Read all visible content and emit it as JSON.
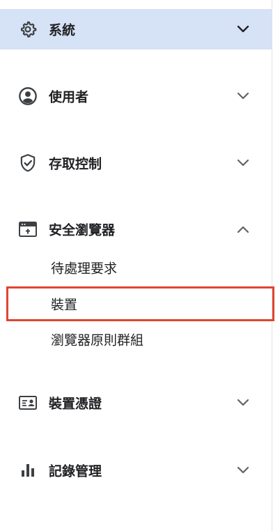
{
  "sidebar": {
    "items": [
      {
        "label": "系統",
        "icon": "gear-icon",
        "expanded": false,
        "active": true
      },
      {
        "label": "使用者",
        "icon": "account-circle-icon",
        "expanded": false
      },
      {
        "label": "存取控制",
        "icon": "shield-check-icon",
        "expanded": false
      },
      {
        "label": "安全瀏覽器",
        "icon": "browser-window-icon",
        "expanded": true,
        "children": [
          {
            "label": "待處理要求"
          },
          {
            "label": "裝置",
            "highlighted": true
          },
          {
            "label": "瀏覽器原則群組"
          }
        ]
      },
      {
        "label": "裝置憑證",
        "icon": "id-card-icon",
        "expanded": false
      },
      {
        "label": "記錄管理",
        "icon": "bar-chart-icon",
        "expanded": false
      }
    ]
  },
  "colors": {
    "active_background": "#d6e2f5",
    "highlight_border": "#e0452f",
    "text": "#202124",
    "icon": "#3c4043"
  }
}
